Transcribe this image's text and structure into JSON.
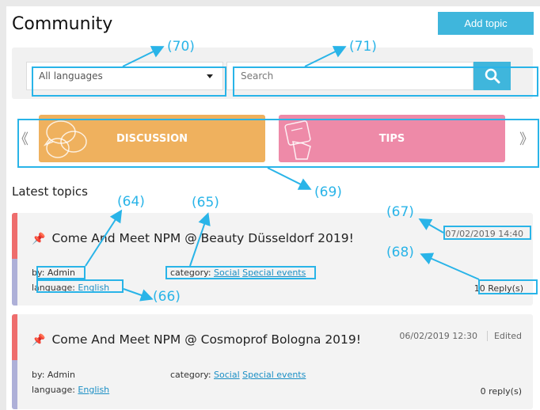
{
  "header": {
    "title": "Community",
    "add_topic_label": "Add topic"
  },
  "filters": {
    "language_selected": "All languages",
    "search_placeholder": "Search"
  },
  "categories": [
    {
      "label": "DISCUSSION",
      "color": "#efb15e",
      "icon": "speech-bubbles-icon"
    },
    {
      "label": "TIPS",
      "color": "#ee8aa8",
      "icon": "hand-note-icon"
    }
  ],
  "carousel": {
    "prev_glyph": "《",
    "next_glyph": "》"
  },
  "latest_heading": "Latest topics",
  "topics": [
    {
      "title": "Come And Meet NPM @ Beauty Düsseldorf 2019!",
      "by": "by: Admin",
      "language_label": "language:",
      "language": "English",
      "category_label": "category:",
      "categories": [
        "Social",
        "Special events"
      ],
      "date": "07/02/2019 14:40",
      "replies": "10 Reply(s)"
    },
    {
      "title": "Come And Meet NPM @ Cosmoprof Bologna 2019!",
      "by": "by: Admin",
      "language_label": "language:",
      "language": "English",
      "category_label": "category:",
      "categories": [
        "Social",
        "Special events"
      ],
      "date": "06/02/2019 12:30",
      "edited": "Edited",
      "replies": "0 reply(s)"
    }
  ],
  "annotations": [
    "(70)",
    "(71)",
    "(69)",
    "(64)",
    "(65)",
    "(67)",
    "(68)",
    "(66)"
  ],
  "colors": {
    "accent": "#3fb6dc",
    "annotation": "#29b4e8",
    "pin_red": "#ee6d6d",
    "pin_purple": "#aeb0d8"
  }
}
